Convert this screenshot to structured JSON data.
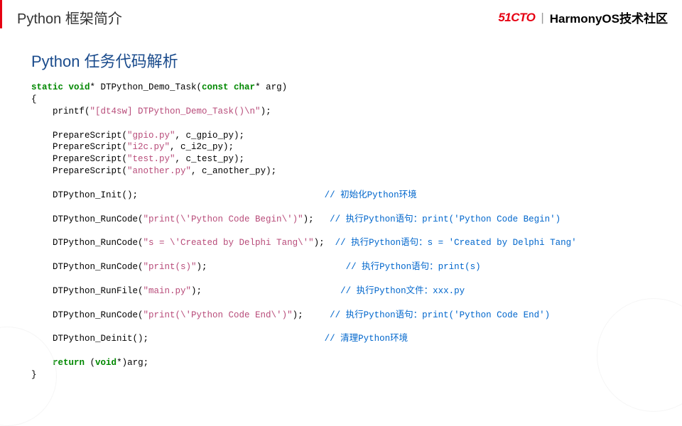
{
  "header": {
    "title": "Python 框架简介",
    "brand_51cto": "51CTO",
    "brand_divider": "|",
    "brand_harmony": "HarmonyOS技术社区"
  },
  "section_title": "Python 任务代码解析",
  "code": {
    "sig_p1": "static void",
    "sig_p2": "* DTPython_Demo_Task(",
    "sig_p3": "const char",
    "sig_p4": "* arg)",
    "open_brace": "{",
    "l1a": "    printf(",
    "l1b": "\"[dt4sw] DTPython_Demo_Task()\\n\"",
    "l1c": ");",
    "l2a": "    PrepareScript(",
    "l2b": "\"gpio.py\"",
    "l2c": ", c_gpio_py);",
    "l3a": "    PrepareScript(",
    "l3b": "\"i2c.py\"",
    "l3c": ", c_i2c_py);",
    "l4a": "    PrepareScript(",
    "l4b": "\"test.py\"",
    "l4c": ", c_test_py);",
    "l5a": "    PrepareScript(",
    "l5b": "\"another.py\"",
    "l5c": ", c_another_py);",
    "l6a": "    DTPython_Init();",
    "l6c": "// 初始化Python环境",
    "l7a": "    DTPython_RunCode(",
    "l7b": "\"print(\\'Python Code Begin\\')\"",
    "l7c": ");",
    "l7d": "// 执行Python语句：print('Python Code Begin')",
    "l8a": "    DTPython_RunCode(",
    "l8b": "\"s = \\'Created by Delphi Tang\\'\"",
    "l8c": ");",
    "l8d": "// 执行Python语句：s = 'Created by Delphi Tang'",
    "l9a": "    DTPython_RunCode(",
    "l9b": "\"print(s)\"",
    "l9c": ");",
    "l9d": "// 执行Python语句：print(s)",
    "l10a": "    DTPython_RunFile(",
    "l10b": "\"main.py\"",
    "l10c": ");",
    "l10d": " // 执行Python文件：xxx.py",
    "l11a": "    DTPython_RunCode(",
    "l11b": "\"print(\\'Python Code End\\')\"",
    "l11c": ");",
    "l11d": "// 执行Python语句：print('Python Code End')",
    "l12a": "    DTPython_Deinit();",
    "l12d": "// 清理Python环境",
    "l13a": "    ",
    "l13b": "return",
    "l13c": " (",
    "l13d": "void",
    "l13e": "*)arg;",
    "close_brace": "}",
    "pad6": "                                   ",
    "pad7": "   ",
    "pad8": "  ",
    "pad9": "                          ",
    "pad10": "                         ",
    "pad11": "     ",
    "pad12": "                                 "
  }
}
